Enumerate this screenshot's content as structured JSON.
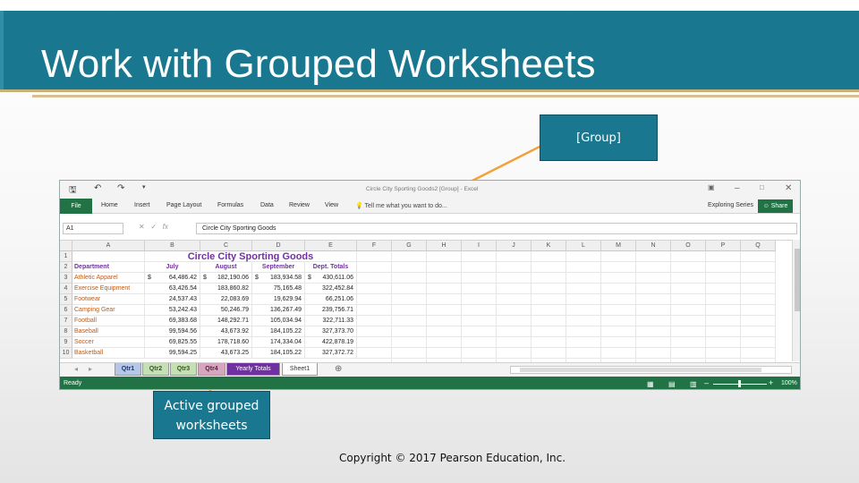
{
  "slide": {
    "title": "Work with Grouped Worksheets",
    "copyright": "Copyright © 2017 Pearson Education, Inc.",
    "callout_group": "[Group]",
    "callout_active": "Active grouped worksheets"
  },
  "window": {
    "title": "Circle City Sporting Goods2 [Group] - Excel",
    "qat_icons": [
      "save-icon",
      "undo-icon",
      "redo-icon",
      "customize-icon"
    ],
    "controls": [
      "ribbon-options-icon",
      "minimize-icon",
      "maximize-icon",
      "close-icon"
    ]
  },
  "ribbon": {
    "file": "File",
    "tabs": [
      "Home",
      "Insert",
      "Page Layout",
      "Formulas",
      "Data",
      "Review",
      "View"
    ],
    "tell_me": "Tell me what you want to do...",
    "exploring": "Exploring Series",
    "share": "Share"
  },
  "formula_bar": {
    "name_box": "A1",
    "content": "Circle City Sporting Goods"
  },
  "sheet": {
    "columns": [
      "A",
      "B",
      "C",
      "D",
      "E",
      "F",
      "G",
      "H",
      "I",
      "J",
      "K",
      "L",
      "M",
      "N",
      "O",
      "P",
      "Q"
    ],
    "rows": [
      "1",
      "2",
      "3",
      "4",
      "5",
      "6",
      "7",
      "8",
      "9",
      "10"
    ],
    "title": "Circle City Sporting Goods",
    "headers": [
      "Department",
      "July",
      "August",
      "September",
      "Dept. Totals"
    ],
    "data": [
      [
        "Athletic Apparel",
        "$",
        "64,486.42",
        "$",
        "182,190.06",
        "$",
        "183,934.58",
        "$",
        "430,611.06"
      ],
      [
        "Exercise Equipment",
        "",
        "63,426.54",
        "",
        "183,860.82",
        "",
        "75,165.48",
        "",
        "322,452.84"
      ],
      [
        "Footwear",
        "",
        "24,537.43",
        "",
        "22,083.69",
        "",
        "19,629.94",
        "",
        "66,251.06"
      ],
      [
        "Camping Gear",
        "",
        "53,242.43",
        "",
        "50,246.79",
        "",
        "136,267.49",
        "",
        "239,756.71"
      ],
      [
        "Football",
        "",
        "69,383.68",
        "",
        "148,292.71",
        "",
        "105,034.94",
        "",
        "322,711.33"
      ],
      [
        "Baseball",
        "",
        "99,594.56",
        "",
        "43,673.92",
        "",
        "184,105.22",
        "",
        "327,373.70"
      ],
      [
        "Soccer",
        "",
        "69,825.55",
        "",
        "178,718.60",
        "",
        "174,334.04",
        "",
        "422,878.19"
      ],
      [
        "Basketball",
        "",
        "99,594.25",
        "",
        "43,673.25",
        "",
        "184,105.22",
        "",
        "327,372.72"
      ]
    ]
  },
  "sheet_tabs": [
    "Qtr1",
    "Qtr2",
    "Qtr3",
    "Qtr4",
    "Yearly Totals",
    "Sheet1"
  ],
  "status_bar": {
    "ready": "Ready",
    "zoom": "100%"
  },
  "colors": {
    "slide_teal": "#19788f",
    "gold": "#c9b27a",
    "excel_green": "#217346",
    "dept_orange": "#c35a12",
    "header_purple": "#7030a0"
  }
}
